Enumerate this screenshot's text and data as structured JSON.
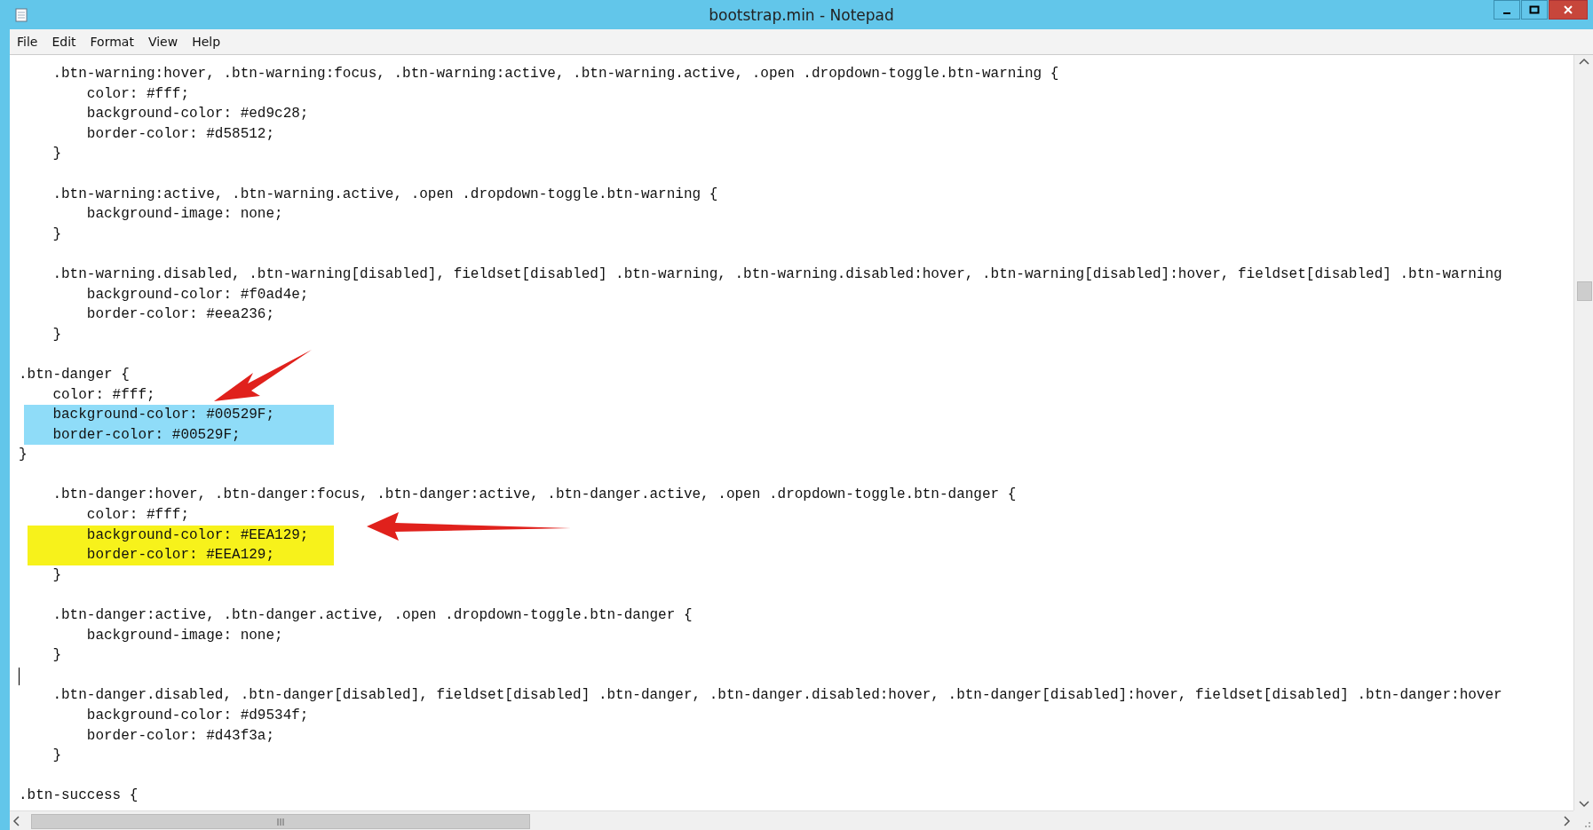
{
  "window": {
    "title": "bootstrap.min - Notepad"
  },
  "menu": [
    "File",
    "Edit",
    "Format",
    "View",
    "Help"
  ],
  "lines": [
    {
      "kind": "indent",
      "text": ".btn-warning:hover, .btn-warning:focus, .btn-warning:active, .btn-warning.active, .open .dropdown-toggle.btn-warning {"
    },
    {
      "kind": "deep",
      "text": "color: #fff;"
    },
    {
      "kind": "deep",
      "text": "background-color: #ed9c28;"
    },
    {
      "kind": "deep",
      "text": "border-color: #d58512;"
    },
    {
      "kind": "indent",
      "text": "}"
    },
    {
      "kind": "blank"
    },
    {
      "kind": "indent",
      "text": ".btn-warning:active, .btn-warning.active, .open .dropdown-toggle.btn-warning {"
    },
    {
      "kind": "deep",
      "text": "background-image: none;"
    },
    {
      "kind": "indent",
      "text": "}"
    },
    {
      "kind": "blank"
    },
    {
      "kind": "indent",
      "text": ".btn-warning.disabled, .btn-warning[disabled], fieldset[disabled] .btn-warning, .btn-warning.disabled:hover, .btn-warning[disabled]:hover, fieldset[disabled] .btn-warning"
    },
    {
      "kind": "deep",
      "text": "background-color: #f0ad4e;"
    },
    {
      "kind": "deep",
      "text": "border-color: #eea236;"
    },
    {
      "kind": "indent",
      "text": "}"
    },
    {
      "kind": "blank"
    },
    {
      "kind": "flush",
      "text": ".btn-danger {"
    },
    {
      "kind": "indent",
      "text": "color: #fff;"
    },
    {
      "kind": "indent",
      "text": "background-color: #00529F;",
      "color": "#8fdcf8"
    },
    {
      "kind": "indent",
      "text": "border-color: #00529F;",
      "color": "#8fdcf8"
    },
    {
      "kind": "flush",
      "text": "}"
    },
    {
      "kind": "blank"
    },
    {
      "kind": "indent",
      "text": ".btn-danger:hover, .btn-danger:focus, .btn-danger:active, .btn-danger.active, .open .dropdown-toggle.btn-danger {"
    },
    {
      "kind": "deep",
      "text": "color: #fff;"
    },
    {
      "kind": "deep",
      "text": "background-color: #EEA129;",
      "color": "#f7f21b"
    },
    {
      "kind": "deep",
      "text": "border-color: #EEA129;",
      "color": "#f7f21b"
    },
    {
      "kind": "indent",
      "text": "}"
    },
    {
      "kind": "blank"
    },
    {
      "kind": "indent",
      "text": ".btn-danger:active, .btn-danger.active, .open .dropdown-toggle.btn-danger {"
    },
    {
      "kind": "deep",
      "text": "background-image: none;"
    },
    {
      "kind": "indent",
      "text": "}"
    },
    {
      "kind": "caret"
    },
    {
      "kind": "indent",
      "text": ".btn-danger.disabled, .btn-danger[disabled], fieldset[disabled] .btn-danger, .btn-danger.disabled:hover, .btn-danger[disabled]:hover, fieldset[disabled] .btn-danger:hover"
    },
    {
      "kind": "deep",
      "text": "background-color: #d9534f;"
    },
    {
      "kind": "deep",
      "text": "border-color: #d43f3a;"
    },
    {
      "kind": "indent",
      "text": "}"
    },
    {
      "kind": "blank"
    },
    {
      "kind": "flush",
      "text": ".btn-success {"
    }
  ]
}
